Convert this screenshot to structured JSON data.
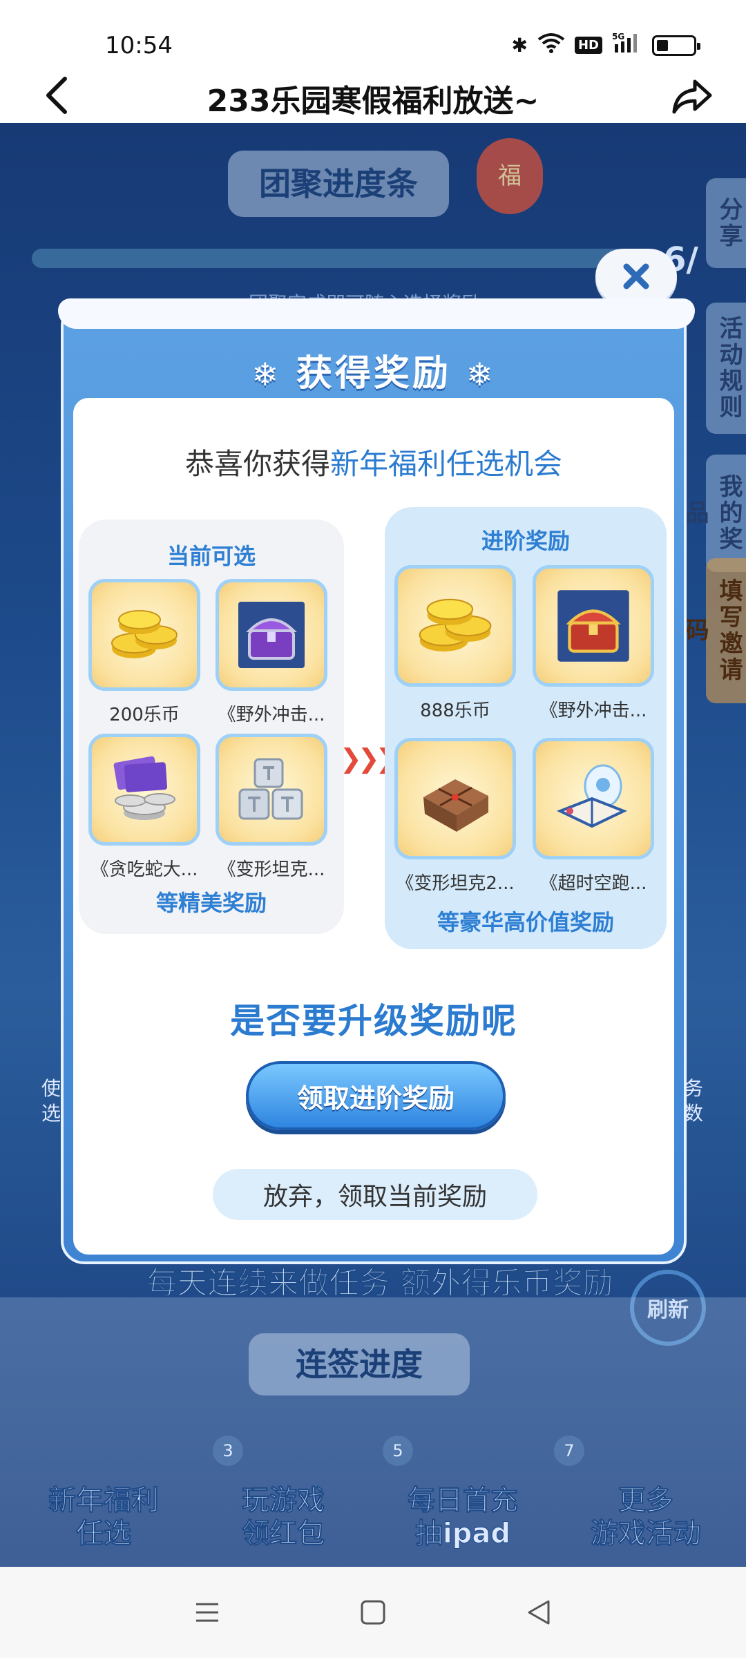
{
  "status_bar": {
    "time": "10:54",
    "network": "5G",
    "hd": "HD"
  },
  "title_bar": {
    "title": "233乐园寒假福利放送~"
  },
  "background": {
    "reunion_bar": "团聚进度条",
    "progress_count": "6/",
    "progress_hint": "团聚完成即可随心选择奖励",
    "side_tabs": [
      "分享",
      "活动规则",
      "我的奖品",
      "填写邀请码"
    ],
    "daily_banner": "每天连续来做任务 额外得乐币奖励",
    "refresh": "刷新",
    "signin_bar": "连签进度",
    "day_numbers": [
      "3",
      "5",
      "7"
    ],
    "bottom_items": [
      {
        "line1": "新年福利",
        "line2": "任选"
      },
      {
        "line1": "玩游戏",
        "line2": "领红包"
      },
      {
        "line1": "每日首充",
        "line2": "抽ipad"
      },
      {
        "line1": "更多",
        "line2": "游戏活动"
      }
    ],
    "fu_badge": "福",
    "left_peek": "使 选",
    "right_peek": "务 数"
  },
  "modal": {
    "title": "获得奖励",
    "congrats_prefix": "恭喜你获得",
    "congrats_highlight": "新年福利任选机会",
    "current": {
      "heading": "当前可选",
      "items": [
        "200乐币",
        "《野外冲击...",
        "《贪吃蛇大...",
        "《变形坦克..."
      ],
      "footer": "等精美奖励"
    },
    "advanced": {
      "heading": "进阶奖励",
      "items": [
        "888乐币",
        "《野外冲击...",
        "《变形坦克2...",
        "《超时空跑..."
      ],
      "footer": "等豪华高价值奖励"
    },
    "question": "是否要升级奖励呢",
    "upgrade_button": "领取进阶奖励",
    "giveup_button": "放弃，领取当前奖励",
    "colors": {
      "accent": "#2b7bd0",
      "modal_blue": "#4a8ed8",
      "tile_gold": "#fbe2a1"
    }
  },
  "nav_bar": {
    "icons": [
      "menu-icon",
      "home-square-icon",
      "back-triangle-icon"
    ]
  }
}
